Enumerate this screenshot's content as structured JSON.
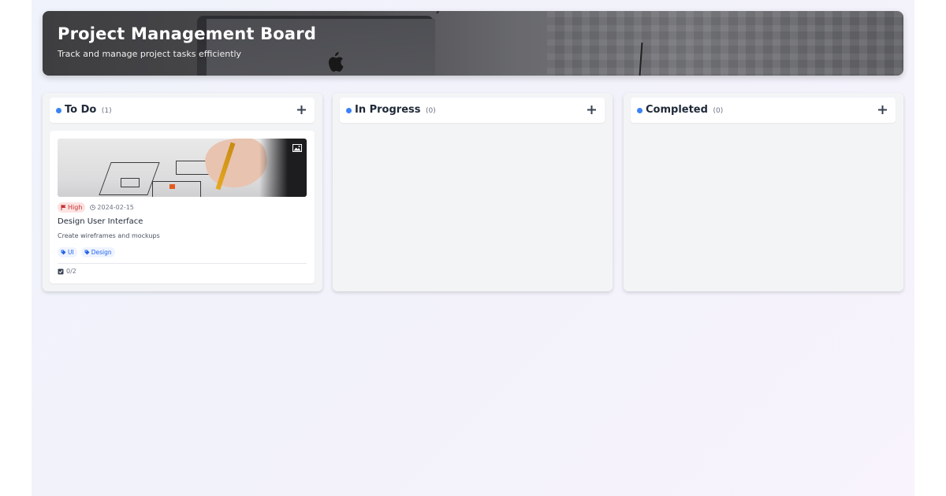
{
  "header": {
    "title": "Project Management Board",
    "subtitle": "Track and manage project tasks efficiently"
  },
  "colors": {
    "accent": "#3b82f6",
    "priority_high_bg": "#fde2e2",
    "priority_high_text": "#c53030",
    "tag_bg": "#eef4ff",
    "tag_text": "#2563eb"
  },
  "columns": [
    {
      "title": "To Do",
      "count": "(1)",
      "add_icon": "plus-icon",
      "cards": [
        {
          "image_icon": "image-icon",
          "priority": "High",
          "priority_icon": "flag-icon",
          "due_date": "2024-02-15",
          "due_icon": "clock-icon",
          "title": "Design User Interface",
          "description": "Create wireframes and mockups",
          "tags": [
            "UI",
            "Design"
          ],
          "tag_icon": "tag-icon",
          "subtasks": "0/2",
          "subtasks_icon": "checkbox-icon"
        }
      ]
    },
    {
      "title": "In Progress",
      "count": "(0)",
      "add_icon": "plus-icon",
      "cards": []
    },
    {
      "title": "Completed",
      "count": "(0)",
      "add_icon": "plus-icon",
      "cards": []
    }
  ]
}
